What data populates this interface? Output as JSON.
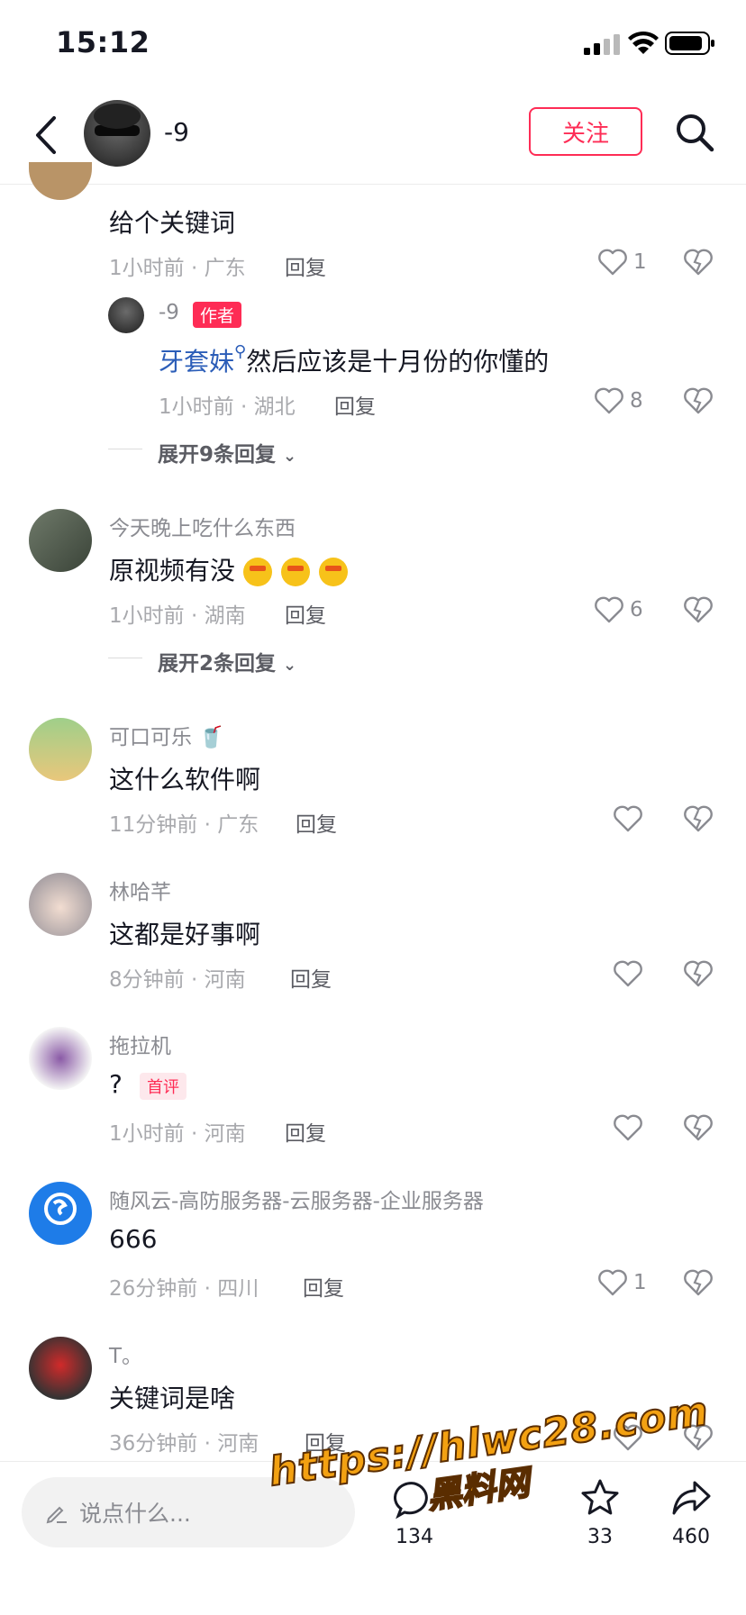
{
  "status": {
    "time": "15:12"
  },
  "header": {
    "username": "-9",
    "follow_label": "关注"
  },
  "comments": [
    {
      "username_partial": "",
      "text": "给个关键词",
      "time": "1小时前 · 广东",
      "reply_label": "回复",
      "likes": "1"
    },
    {
      "username": "-9",
      "badge": "作者",
      "mention": "牙套妹",
      "text": "然后应该是十月份的你懂的",
      "time": "1小时前 · 湖北",
      "reply_label": "回复",
      "likes": "8",
      "is_reply": true
    },
    {
      "username": "今天晚上吃什么东西",
      "text": "原视频有没",
      "time": "1小时前 · 湖南",
      "reply_label": "回复",
      "likes": "6"
    },
    {
      "username": "可口可乐",
      "text": "这什么软件啊",
      "time": "11分钟前 · 广东",
      "reply_label": "回复",
      "likes": ""
    },
    {
      "username": "林哈芊",
      "text": "这都是好事啊",
      "time": "8分钟前 · 河南",
      "reply_label": "回复",
      "likes": ""
    },
    {
      "username": "拖拉机",
      "text": "?",
      "badge": "首评",
      "time": "1小时前 · 河南",
      "reply_label": "回复",
      "likes": ""
    },
    {
      "username": "随风云-高防服务器-云服务器-企业服务器",
      "text": "666",
      "time": "26分钟前 · 四川",
      "reply_label": "回复",
      "likes": "1"
    },
    {
      "username": "T。",
      "text": "关键词是啥",
      "time": "36分钟前 · 河南",
      "reply_label": "回复",
      "likes": ""
    }
  ],
  "expand": [
    {
      "label": "展开9条回复"
    },
    {
      "label": "展开2条回复"
    }
  ],
  "bottom": {
    "placeholder": "说点什么...",
    "comment_count": "134",
    "star_count": "33",
    "share_count": "460"
  },
  "watermark": {
    "line1": "https://hlwc28.com",
    "line2": "黑料网"
  },
  "colors": {
    "accent": "#fe2c55",
    "mention": "#2b5db8"
  }
}
